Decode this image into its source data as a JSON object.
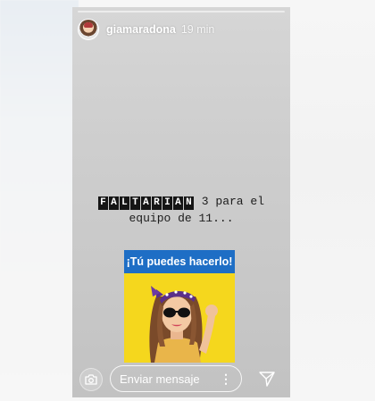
{
  "story": {
    "username": "giamaradona",
    "time": "19 min"
  },
  "caption": {
    "tile_letters": [
      "F",
      "A",
      "L",
      "T",
      "A",
      "R",
      "I",
      "A",
      "N"
    ],
    "line1_rest": " 3 para el",
    "line2": "equipo de 11..."
  },
  "sticker": {
    "banner": "¡Tú puedes hacerlo!"
  },
  "reply_bar": {
    "placeholder": "Enviar mensaje",
    "more": "⋮"
  },
  "icons": {
    "camera": "camera-icon",
    "send": "paper-plane-icon",
    "more": "more-options-icon"
  },
  "colors": {
    "sticker_background": "#f5d71d",
    "sticker_banner": "#1e6ec5",
    "story_background": "#cccccc"
  }
}
